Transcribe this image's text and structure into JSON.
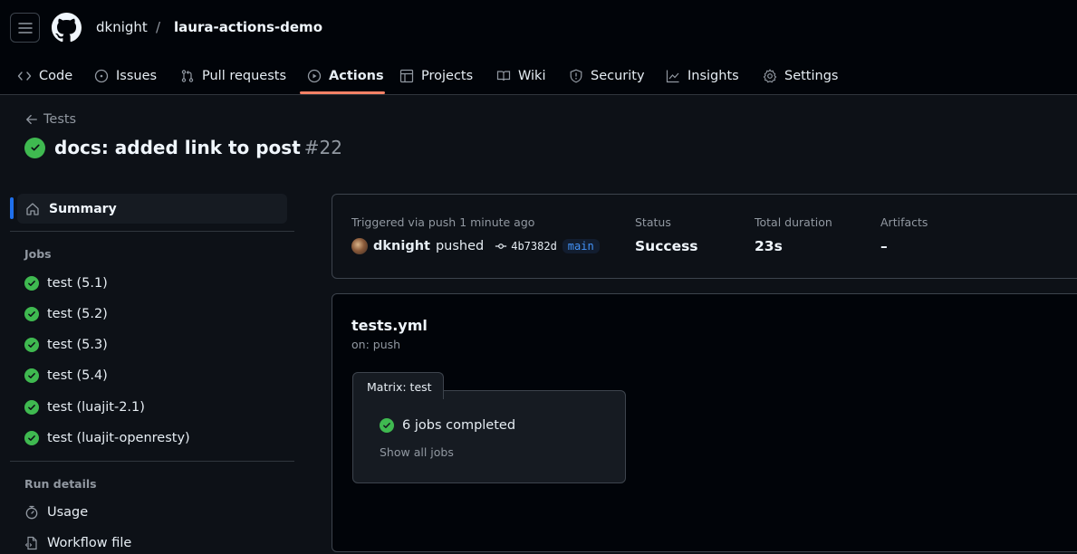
{
  "header": {
    "owner": "dknight",
    "separator": "/",
    "repo": "laura-actions-demo"
  },
  "nav": {
    "tabs": [
      {
        "label": "Code",
        "icon": "code-icon",
        "active": false
      },
      {
        "label": "Issues",
        "icon": "issue-icon",
        "active": false
      },
      {
        "label": "Pull requests",
        "icon": "pull-request-icon",
        "active": false
      },
      {
        "label": "Actions",
        "icon": "play-icon",
        "active": true
      },
      {
        "label": "Projects",
        "icon": "table-icon",
        "active": false
      },
      {
        "label": "Wiki",
        "icon": "book-icon",
        "active": false
      },
      {
        "label": "Security",
        "icon": "shield-icon",
        "active": false
      },
      {
        "label": "Insights",
        "icon": "graph-icon",
        "active": false
      },
      {
        "label": "Settings",
        "icon": "gear-icon",
        "active": false
      }
    ],
    "accent": "#f78166"
  },
  "run": {
    "back_label": "Tests",
    "title": "docs: added link to post",
    "number": "#22",
    "status_color": "#3fb950"
  },
  "sidebar": {
    "summary_label": "Summary",
    "jobs_heading": "Jobs",
    "jobs": [
      {
        "label": "test (5.1)",
        "status": "success"
      },
      {
        "label": "test (5.2)",
        "status": "success"
      },
      {
        "label": "test (5.3)",
        "status": "success"
      },
      {
        "label": "test (5.4)",
        "status": "success"
      },
      {
        "label": "test (luajit-2.1)",
        "status": "success"
      },
      {
        "label": "test (luajit-openresty)",
        "status": "success"
      }
    ],
    "run_details_heading": "Run details",
    "run_details": [
      {
        "label": "Usage",
        "icon": "stopwatch-icon"
      },
      {
        "label": "Workflow file",
        "icon": "file-code-icon"
      }
    ]
  },
  "summary": {
    "trigger_label": "Triggered via push 1 minute ago",
    "actor": "dknight",
    "action": "pushed",
    "commit_sha": "4b7382d",
    "branch": "main",
    "status_label": "Status",
    "status_value": "Success",
    "duration_label": "Total duration",
    "duration_value": "23s",
    "artifacts_label": "Artifacts",
    "artifacts_value": "–"
  },
  "workflow": {
    "file": "tests.yml",
    "trigger": "on: push",
    "matrix_label": "Matrix: test",
    "jobs_completed": "6 jobs completed",
    "show_all": "Show all jobs"
  }
}
